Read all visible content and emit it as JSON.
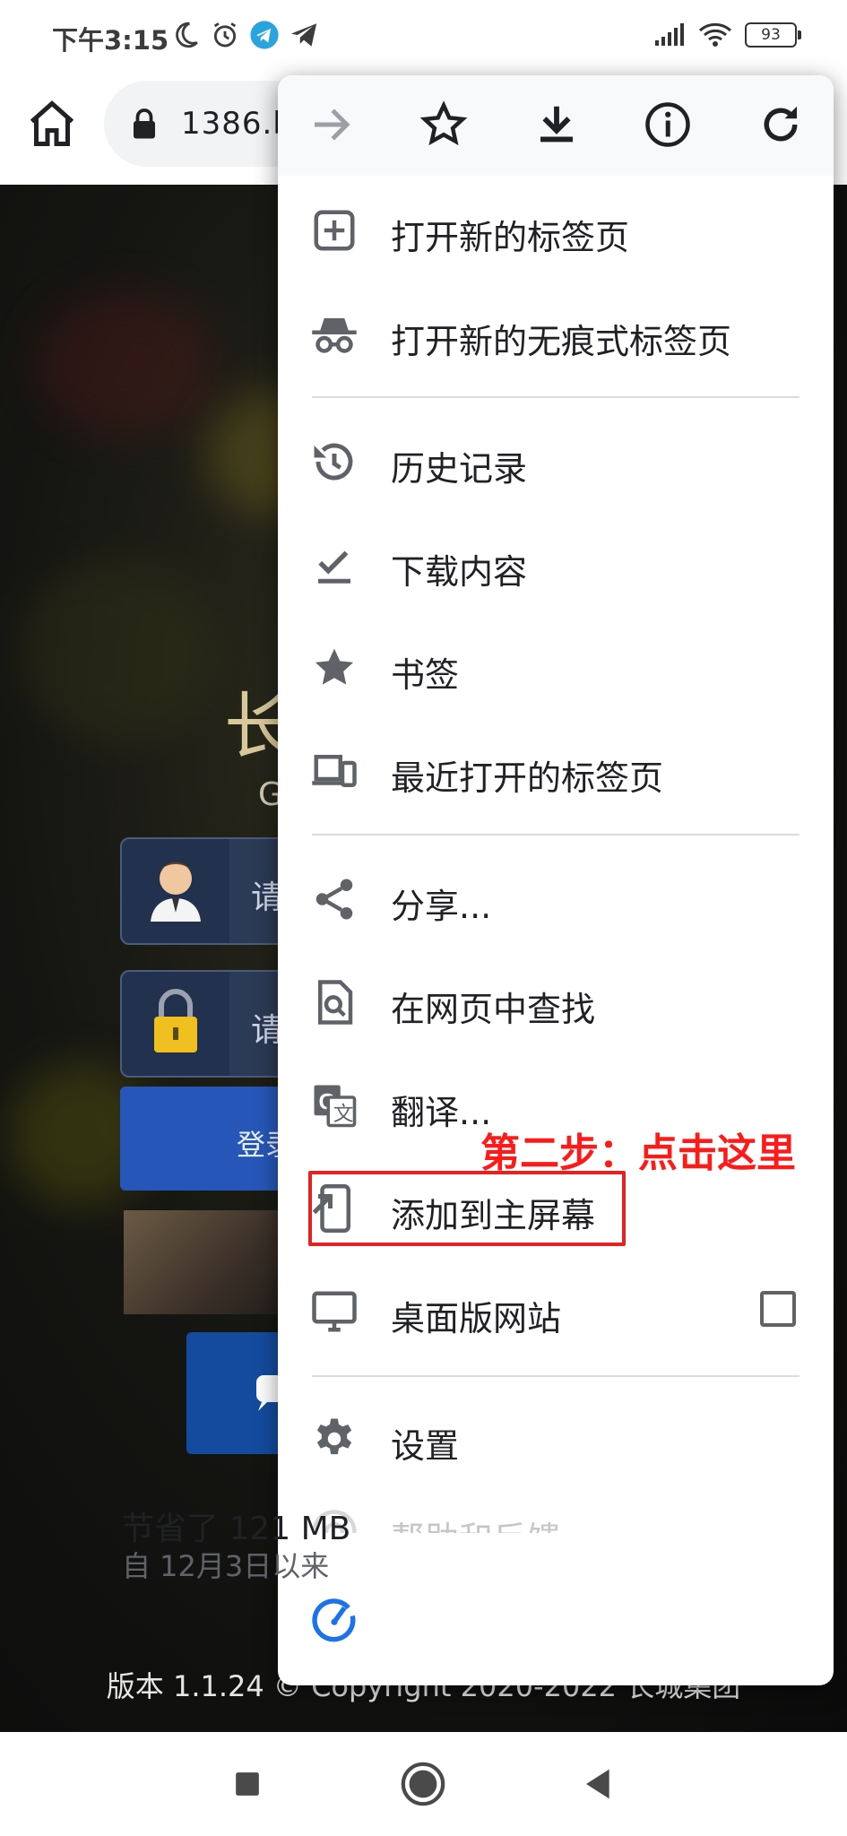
{
  "status_bar": {
    "time": "下午3:15",
    "battery": "93",
    "icons": [
      "moon-icon",
      "alarm-icon",
      "telegram-icon",
      "send-icon",
      "signal-icon",
      "wifi-icon",
      "battery-icon"
    ]
  },
  "toolbar": {
    "url": "1386.b",
    "icons": [
      "home-icon",
      "lock-icon"
    ]
  },
  "page": {
    "title": "长",
    "subtitle": "G",
    "username_placeholder": "请",
    "password_placeholder": "请",
    "login_label": "登录",
    "footer": "版本 1.1.24 © Copyright 2020-2022 长城集团"
  },
  "menu": {
    "top_icons": [
      "forward-icon",
      "star-icon",
      "download-icon",
      "info-icon",
      "refresh-icon"
    ],
    "items": [
      {
        "label": "打开新的标签页",
        "icon": "new-tab-icon"
      },
      {
        "label": "打开新的无痕式标签页",
        "icon": "incognito-icon"
      },
      {
        "label": "历史记录",
        "icon": "history-icon"
      },
      {
        "label": "下载内容",
        "icon": "downloads-icon"
      },
      {
        "label": "书签",
        "icon": "bookmarks-icon"
      },
      {
        "label": "最近打开的标签页",
        "icon": "recent-tabs-icon"
      },
      {
        "label": "分享...",
        "icon": "share-icon"
      },
      {
        "label": "在网页中查找",
        "icon": "find-in-page-icon"
      },
      {
        "label": "翻译...",
        "icon": "translate-icon"
      },
      {
        "label": "添加到主屏幕",
        "icon": "add-to-home-icon"
      },
      {
        "label": "桌面版网站",
        "icon": "desktop-icon"
      },
      {
        "label": "设置",
        "icon": "settings-icon"
      },
      {
        "label": "帮助和反馈",
        "icon": "help-icon"
      }
    ],
    "data_saver": {
      "title": "节省了 121 MB",
      "subtitle": "自 12月3日以来",
      "icon": "data-saver-icon"
    }
  },
  "annotation": {
    "text": "第二步：点击这里",
    "color": "#ff1a1a"
  },
  "colors": {
    "accent_blue": "#1a73e8",
    "menu_text": "#202124",
    "icon_gray": "#5f6368"
  },
  "navbar": {
    "icons": [
      "recents-square-icon",
      "home-circle-icon",
      "back-triangle-icon"
    ]
  }
}
